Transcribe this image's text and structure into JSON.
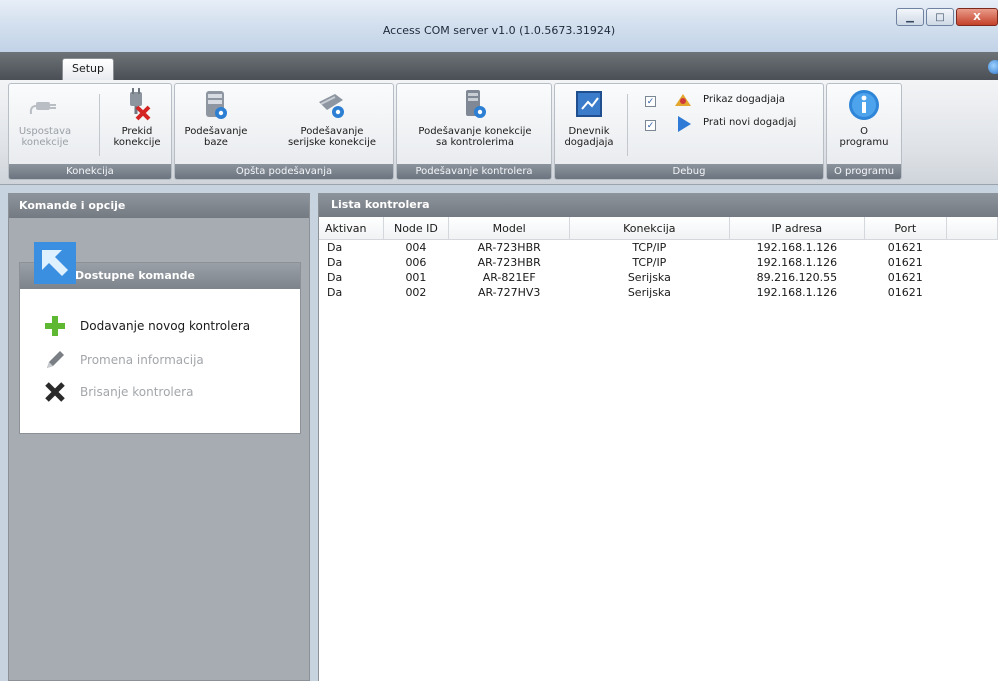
{
  "window": {
    "title": "Access COM server v1.0 (1.0.5673.31924)",
    "controls": [
      "minimize",
      "maximize",
      "close"
    ]
  },
  "tabs": [
    {
      "label": "Setup",
      "active": true
    }
  ],
  "ribbon": {
    "groups": [
      {
        "label": "Konekcija",
        "buttons": [
          {
            "label1": "Uspostava",
            "label2": "konekcije",
            "enabled": false,
            "icon": "plug-icon"
          },
          {
            "label1": "Prekid",
            "label2": "konekcije",
            "enabled": true,
            "icon": "unplug-icon"
          }
        ]
      },
      {
        "label": "Opšta podešavanja",
        "buttons": [
          {
            "label1": "Podešavanje",
            "label2": "baze",
            "enabled": true,
            "icon": "database-icon"
          },
          {
            "label1": "Podešavanje",
            "label2": "serijske konekcije",
            "enabled": true,
            "icon": "serial-cable-icon"
          }
        ]
      },
      {
        "label": "Podešavanje kontrolera",
        "buttons": [
          {
            "label1": "Podešavanje konekcije",
            "label2": "sa kontrolerima",
            "enabled": true,
            "icon": "controller-settings-icon"
          }
        ]
      },
      {
        "label": "Debug",
        "buttons": [
          {
            "label1": "Dnevnik",
            "label2": "dogadjaja",
            "enabled": true,
            "icon": "log-icon"
          }
        ],
        "checks": [
          {
            "label": "Prikaz dogadjaja",
            "checked": true,
            "icon": "events-icon"
          },
          {
            "label": "Prati novi dogadjaj",
            "checked": true,
            "icon": "play-icon"
          }
        ]
      },
      {
        "label": "O programu",
        "buttons": [
          {
            "label1": "O",
            "label2": "programu",
            "enabled": true,
            "icon": "info-icon"
          }
        ]
      }
    ]
  },
  "left_panel": {
    "header": "Komande i opcije",
    "box_title": "Dostupne komande",
    "commands": [
      {
        "label": "Dodavanje novog kontrolera",
        "enabled": true,
        "icon": "plus-icon"
      },
      {
        "label": "Promena informacija",
        "enabled": false,
        "icon": "pencil-icon"
      },
      {
        "label": "Brisanje kontrolera",
        "enabled": false,
        "icon": "delete-x-icon"
      }
    ]
  },
  "right_panel": {
    "header": "Lista kontrolera",
    "columns": [
      "Aktivan",
      "Node ID",
      "Model",
      "Konekcija",
      "IP adresa",
      "Port"
    ],
    "rows": [
      [
        "Da",
        "004",
        "AR-723HBR",
        "TCP/IP",
        "192.168.1.126",
        "01621"
      ],
      [
        "Da",
        "006",
        "AR-723HBR",
        "TCP/IP",
        "192.168.1.126",
        "01621"
      ],
      [
        "Da",
        "001",
        "AR-821EF",
        "Serijska",
        "89.216.120.55",
        "01621"
      ],
      [
        "Da",
        "002",
        "AR-727HV3",
        "Serijska",
        "192.168.1.126",
        "01621"
      ]
    ]
  },
  "colors": {
    "panel_header": "#7f858c",
    "left_background": "#a7acb2",
    "add_green": "#5fb832",
    "accent_blue": "#2a72c8"
  }
}
